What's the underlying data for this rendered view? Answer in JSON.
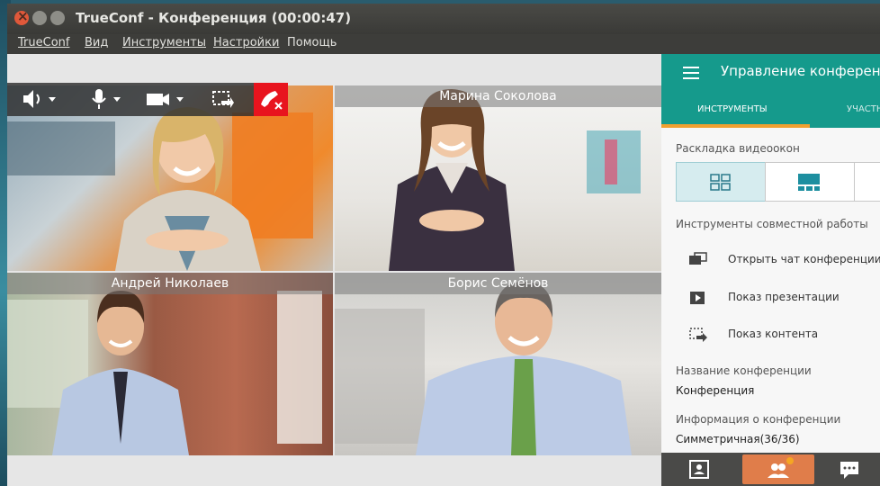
{
  "window": {
    "title": "TrueConf - Конференция (00:00:47)"
  },
  "menu": {
    "items": [
      {
        "label": "TrueConf"
      },
      {
        "label": "Вид"
      },
      {
        "label": "Инструменты"
      },
      {
        "label": "Настройки"
      },
      {
        "label": "Помощь"
      }
    ]
  },
  "participants": {
    "top_right": "Марина Соколова",
    "bottom_left": "Андрей Николаев",
    "bottom_right": "Борис Семёнов"
  },
  "panel": {
    "title": "Управление конференци",
    "tabs": [
      {
        "label": "ИНСТРУМЕНТЫ"
      },
      {
        "label": "УЧАСТН"
      }
    ],
    "layout_heading": "Раскладка видеоокон",
    "collab_heading": "Инструменты совместной работы",
    "tools": [
      {
        "label": "Открыть чат конференции",
        "icon": "chat-icon"
      },
      {
        "label": "Показ презентации",
        "icon": "presentation-icon"
      },
      {
        "label": "Показ контента",
        "icon": "share-content-icon"
      }
    ],
    "conf_name_label": "Название конференции",
    "conf_name_value": "Конференция",
    "conf_info_label": "Информация о конференции",
    "conf_info_value": "Симметричная(36/36)"
  },
  "colors": {
    "accent": "#159a8c",
    "tab_underline": "#f0a030",
    "hangup": "#e8141e"
  }
}
